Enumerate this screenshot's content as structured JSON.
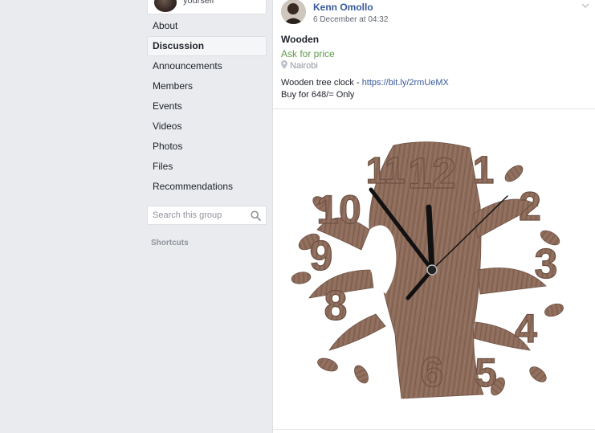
{
  "sidebar": {
    "profile_text": "yourself",
    "nav": [
      {
        "label": "About",
        "active": false
      },
      {
        "label": "Discussion",
        "active": true
      },
      {
        "label": "Announcements",
        "active": false
      },
      {
        "label": "Members",
        "active": false
      },
      {
        "label": "Events",
        "active": false
      },
      {
        "label": "Videos",
        "active": false
      },
      {
        "label": "Photos",
        "active": false
      },
      {
        "label": "Files",
        "active": false
      },
      {
        "label": "Recommendations",
        "active": false
      }
    ],
    "search_placeholder": "Search this group",
    "shortcuts_label": "Shortcuts"
  },
  "post": {
    "author": "Kenn Omollo",
    "date": "6 December at 04:32",
    "title": "Wooden",
    "price": "Ask for price",
    "location": "Nairobi",
    "desc_prefix": "Wooden tree clock - ",
    "link": "https://bit.ly/2rmUeMX",
    "desc_line2": "Buy for 648/= Only",
    "photo_numbers": [
      "12",
      "1",
      "2",
      "3",
      "4",
      "5",
      "6",
      "8",
      "9",
      "10",
      "11"
    ]
  },
  "colors": {
    "link": "#365899",
    "price": "#5d9a4a",
    "wood": "#8b6a58",
    "background": "#e9ebee"
  }
}
